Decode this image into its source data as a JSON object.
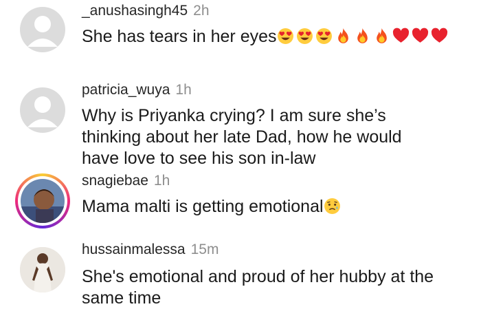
{
  "comments": [
    {
      "username": "_anushasingh45",
      "time": "2h",
      "text": "She has tears in her eyes",
      "emojis": [
        "heart-eyes",
        "heart-eyes",
        "heart-eyes",
        "fire",
        "fire",
        "fire",
        "red-heart",
        "red-heart",
        "red-heart"
      ],
      "avatar": "default"
    },
    {
      "username": "patricia_wuya",
      "time": "1h",
      "text": "Why is  Priyanka crying? I am sure she’s thinking about her late Dad, how he would have love to see his son in-law",
      "avatar": "default"
    },
    {
      "username": "snagiebae",
      "time": "1h",
      "text": "Mama malti is getting emotional",
      "emojis": [
        "disappointed-relieved"
      ],
      "avatar": "photo-with-story-ring"
    },
    {
      "username": "hussainmalessa",
      "time": "15m",
      "text": "She's emotional and proud of her hubby at the same time",
      "avatar": "photo"
    }
  ]
}
